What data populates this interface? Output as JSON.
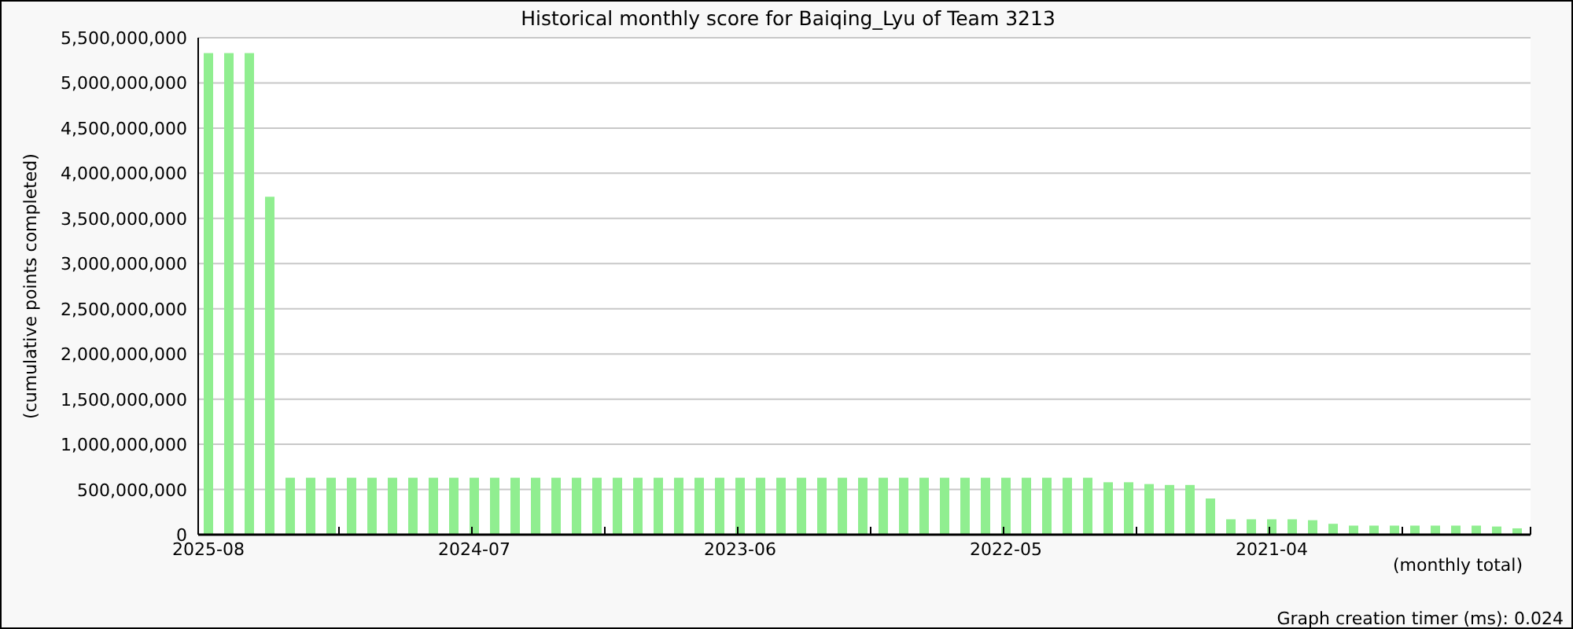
{
  "chart": {
    "chart_data": {
      "type": "bar",
      "title": "Historical monthly score for Baiqing_Lyu of Team 3213",
      "xlabel": "(monthly total)",
      "ylabel": "(cumulative points completed)",
      "ylim": [
        0,
        5500000000
      ],
      "grid": true,
      "yticks": [
        {
          "value": 0,
          "label": "0"
        },
        {
          "value": 500000000,
          "label": "500,000,000"
        },
        {
          "value": 1000000000,
          "label": "1,000,000,000"
        },
        {
          "value": 1500000000,
          "label": "1,500,000,000"
        },
        {
          "value": 2000000000,
          "label": "2,000,000,000"
        },
        {
          "value": 2500000000,
          "label": "2,500,000,000"
        },
        {
          "value": 3000000000,
          "label": "3,000,000,000"
        },
        {
          "value": 3500000000,
          "label": "3,500,000,000"
        },
        {
          "value": 4000000000,
          "label": "4,000,000,000"
        },
        {
          "value": 4500000000,
          "label": "4,500,000,000"
        },
        {
          "value": 5000000000,
          "label": "5,000,000,000"
        },
        {
          "value": 5500000000,
          "label": "5,500,000,000"
        }
      ],
      "categories": [
        "2025-08",
        null,
        null,
        null,
        null,
        null,
        null,
        null,
        null,
        null,
        null,
        null,
        null,
        "2024-07",
        null,
        null,
        null,
        null,
        null,
        null,
        null,
        null,
        null,
        null,
        null,
        null,
        "2023-06",
        null,
        null,
        null,
        null,
        null,
        null,
        null,
        null,
        null,
        null,
        null,
        null,
        "2022-05",
        null,
        null,
        null,
        null,
        null,
        null,
        null,
        null,
        null,
        null,
        null,
        null,
        "2021-04",
        null,
        null,
        null,
        null,
        null,
        null,
        null,
        null,
        null,
        null,
        null,
        null
      ],
      "values": [
        5330000000,
        5330000000,
        5330000000,
        3740000000,
        630000000,
        630000000,
        630000000,
        630000000,
        630000000,
        630000000,
        630000000,
        630000000,
        630000000,
        630000000,
        630000000,
        630000000,
        630000000,
        630000000,
        630000000,
        630000000,
        630000000,
        630000000,
        630000000,
        630000000,
        630000000,
        630000000,
        630000000,
        630000000,
        630000000,
        630000000,
        630000000,
        630000000,
        630000000,
        630000000,
        630000000,
        630000000,
        630000000,
        630000000,
        630000000,
        630000000,
        630000000,
        630000000,
        630000000,
        630000000,
        580000000,
        580000000,
        560000000,
        550000000,
        550000000,
        400000000,
        170000000,
        170000000,
        170000000,
        170000000,
        160000000,
        120000000,
        100000000,
        100000000,
        100000000,
        100000000,
        100000000,
        100000000,
        100000000,
        90000000,
        70000000
      ]
    }
  },
  "footer": {
    "timer": "Graph creation timer (ms): 0.024"
  }
}
